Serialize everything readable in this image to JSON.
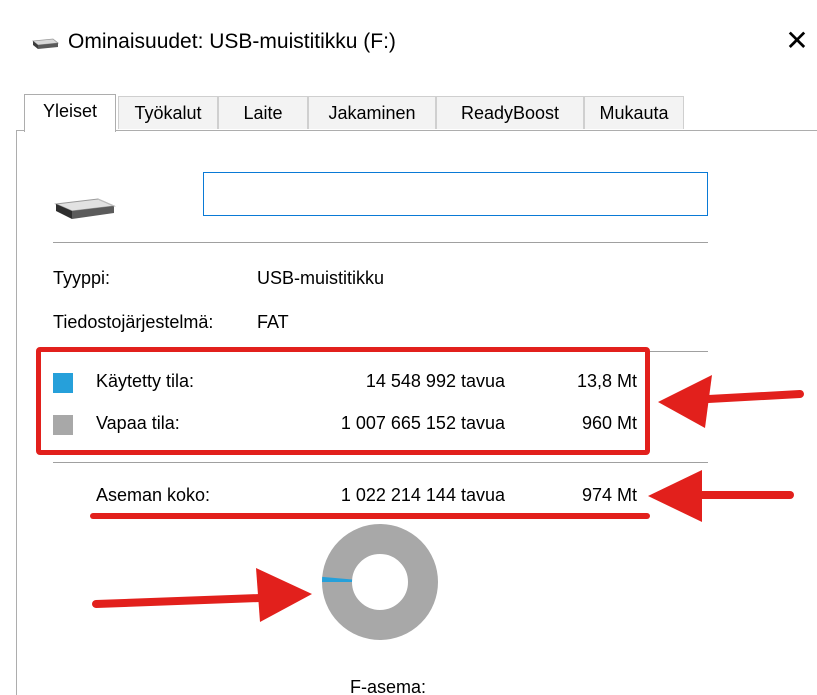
{
  "window": {
    "title": "Ominaisuudet: USB-muistitikku (F:)",
    "close_glyph": "✕"
  },
  "tabs": [
    {
      "label": "Yleiset",
      "active": true
    },
    {
      "label": "Työkalut",
      "active": false
    },
    {
      "label": "Laite",
      "active": false
    },
    {
      "label": "Jakaminen",
      "active": false
    },
    {
      "label": "ReadyBoost",
      "active": false
    },
    {
      "label": "Mukauta",
      "active": false
    }
  ],
  "general": {
    "drive_label_value": "",
    "type_label": "Tyyppi:",
    "type_value": "USB-muistitikku",
    "fs_label": "Tiedostojärjestelmä:",
    "fs_value": "FAT",
    "used": {
      "label": "Käytetty tila:",
      "bytes": "14 548 992 tavua",
      "size": "13,8 Mt",
      "color": "#26a0da"
    },
    "free": {
      "label": "Vapaa tila:",
      "bytes": "1 007 665 152 tavua",
      "size": "960 Mt",
      "color": "#a8a8a8"
    },
    "capacity": {
      "label": "Aseman koko:",
      "bytes": "1 022 214 144 tavua",
      "size": "974 Mt"
    },
    "drive_caption": "F-asema:",
    "used_fraction": 0.0142
  },
  "annotation_color": "#e2201c",
  "icons": {
    "title": "usb-drive-icon",
    "drive": "usb-drive-icon"
  }
}
